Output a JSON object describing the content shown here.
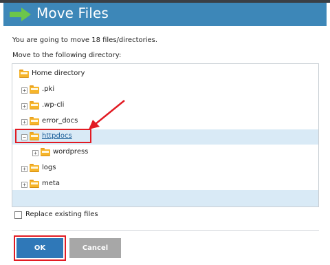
{
  "dialog": {
    "title": "Move Files",
    "info_text": "You are going to move 18 files/directories.",
    "target_label": "Move to the following directory:",
    "replace_label": "Replace existing files",
    "replace_checked": false,
    "ok_label": "OK",
    "cancel_label": "Cancel"
  },
  "tree": {
    "root": "Home directory",
    "items": [
      {
        "label": ".pki",
        "toggle": "+"
      },
      {
        "label": ".wp-cli",
        "toggle": "+"
      },
      {
        "label": "error_docs",
        "toggle": "+"
      },
      {
        "label": "httpdocs",
        "toggle": "−",
        "selected": true
      },
      {
        "label": "wordpress",
        "toggle": "+"
      },
      {
        "label": "logs",
        "toggle": "+"
      },
      {
        "label": "meta",
        "toggle": "+"
      }
    ]
  },
  "colors": {
    "header": "#3d87b8",
    "title_arrow": "#6cc64a",
    "selected_row": "#d9eaf6",
    "annotation": "#e21b23",
    "ok_button": "#2f78b8",
    "cancel_button": "#a7a7a7",
    "folder": "#f6b52b"
  },
  "icons": {
    "title": "right-arrow-icon",
    "folder": "folder-icon",
    "expand": "plus-icon",
    "collapse": "minus-icon"
  }
}
